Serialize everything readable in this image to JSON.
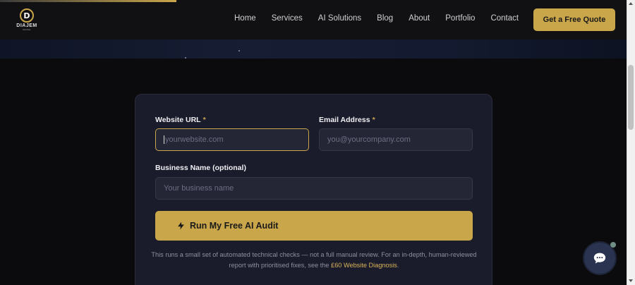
{
  "header": {
    "logo_text": "DIAJEM",
    "logo_sub": "DIGITAL",
    "nav": [
      "Home",
      "Services",
      "AI Solutions",
      "Blog",
      "About",
      "Portfolio",
      "Contact"
    ],
    "cta_label": "Get a Free Quote"
  },
  "form": {
    "website_label": "Website URL",
    "website_placeholder": "yourwebsite.com",
    "email_label": "Email Address",
    "email_placeholder": "you@yourcompany.com",
    "required_mark": "*",
    "business_label": "Business Name (optional)",
    "business_placeholder": "Your business name",
    "submit_label": "Run My Free AI Audit",
    "note_text": "This runs a small set of automated technical checks — not a full manual review. For an in-depth, human-reviewed report with prioritised fixes, see the",
    "note_link": "£60 Website Diagnosis",
    "note_end": "."
  },
  "colors": {
    "accent": "#c9a64a",
    "card_bg": "#1a1b2b",
    "page_bg": "#0b0b0d"
  },
  "icons": {
    "submit": "lightning-bolt-icon",
    "chat": "chat-bubble-icon"
  }
}
